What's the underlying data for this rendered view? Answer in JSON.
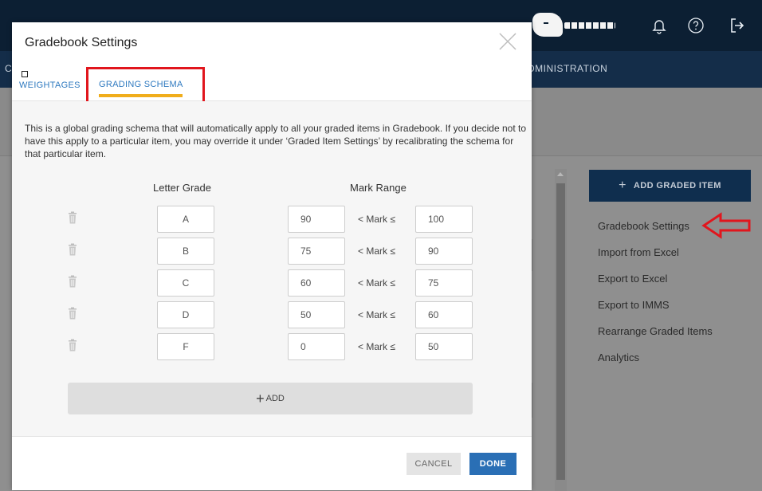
{
  "app": {
    "nav_fragment": "C",
    "nav_administration": "DMINISTRATION",
    "icons": {
      "notifications": "bell-icon",
      "help": "help-circle-icon",
      "logout": "logout-icon"
    },
    "colors": {
      "topbar": "#0c1f33",
      "navbar": "#142d49"
    }
  },
  "sidebar": {
    "add_graded_item_label": "ADD GRADED ITEM",
    "add_icon": "+",
    "items": [
      {
        "label": "Gradebook Settings"
      },
      {
        "label": "Import from Excel"
      },
      {
        "label": "Export to Excel"
      },
      {
        "label": "Export to IMMS"
      },
      {
        "label": "Rearrange Graded Items"
      },
      {
        "label": "Analytics"
      }
    ]
  },
  "modal": {
    "title": "Gradebook Settings",
    "tabs": [
      {
        "label": "WEIGHTAGES",
        "active": false
      },
      {
        "label": "GRADING SCHEMA",
        "active": true
      }
    ],
    "description": "This is a global grading schema that will automatically apply to all your graded items in Gradebook. If you decide not to have this apply to a particular item, you may override it under ‘Graded Item Settings’ by recalibrating the schema for that particular item.",
    "columns": {
      "letter_grade": "Letter Grade",
      "mark_range": "Mark Range"
    },
    "mark_separator": "< Mark ≤",
    "rows": [
      {
        "letter": "A",
        "min": "90",
        "max": "100"
      },
      {
        "letter": "B",
        "min": "75",
        "max": "90"
      },
      {
        "letter": "C",
        "min": "60",
        "max": "75"
      },
      {
        "letter": "D",
        "min": "50",
        "max": "60"
      },
      {
        "letter": "F",
        "min": "0",
        "max": "50"
      }
    ],
    "add_label": "ADD",
    "cancel_label": "CANCEL",
    "done_label": "DONE",
    "colors": {
      "tab_active_underline": "#f0ad1c",
      "link": "#2f7ac0",
      "done": "#2a6fb5",
      "highlight": "#e1161d"
    }
  }
}
